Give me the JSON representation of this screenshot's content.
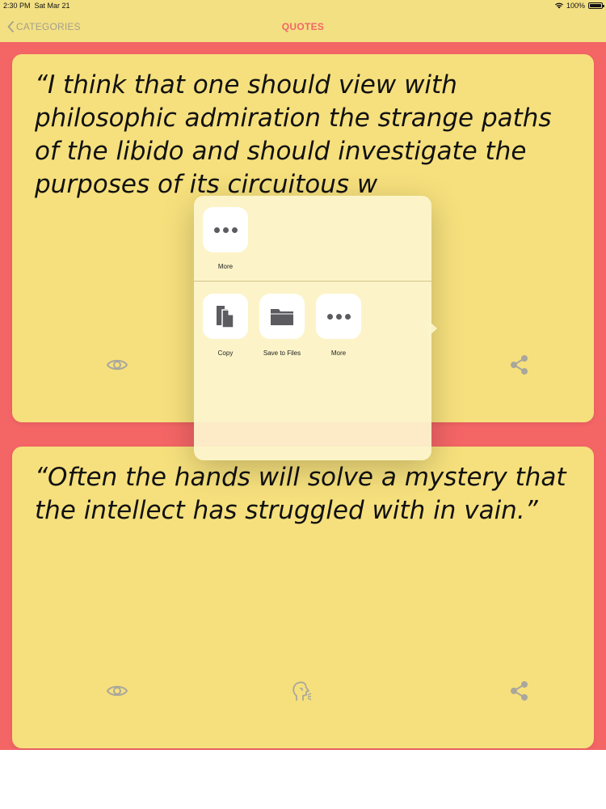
{
  "status_bar": {
    "time": "2:30 PM",
    "date": "Sat Mar 21",
    "battery": "100%"
  },
  "nav": {
    "back_label": "CATEGORIES",
    "title": "QUOTES"
  },
  "quotes": [
    {
      "text": "“I think that one should view with philosophic admiration the strange paths of the libido and should investigate the purposes of its circuitous w"
    },
    {
      "text": "“Often the hands will solve a mystery that the intellect has struggled with in vain.”"
    }
  ],
  "share_sheet": {
    "top_actions": [
      {
        "label": "More",
        "icon": "dots-icon"
      }
    ],
    "bottom_actions": [
      {
        "label": "Copy",
        "icon": "copy-icon"
      },
      {
        "label": "Save to Files",
        "icon": "folder-icon"
      },
      {
        "label": "More",
        "icon": "dots-icon"
      }
    ]
  },
  "colors": {
    "nav_bg": "#f3e083",
    "accent": "#f26667",
    "page_bg": "#f46566",
    "card_bg": "#f6e07d",
    "icon": "#a9a79c"
  }
}
